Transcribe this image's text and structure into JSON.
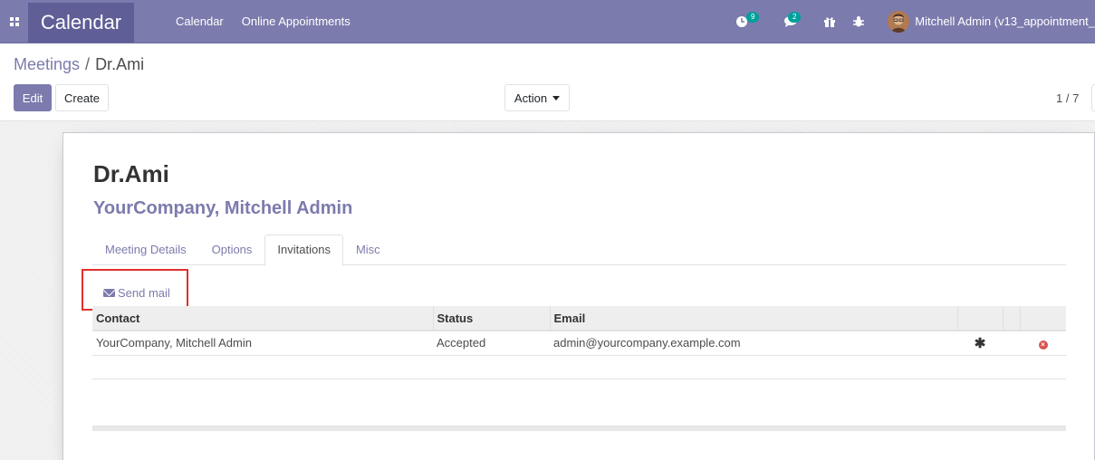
{
  "navbar": {
    "app_title": "Calendar",
    "menu": [
      "Calendar",
      "Online Appointments"
    ],
    "activity_count": "9",
    "messages_count": "2",
    "user_name": "Mitchell Admin (v13_appointment_"
  },
  "icons": {
    "apps": "apps-grid-icon",
    "activity": "clock-icon",
    "messages": "chat-icon",
    "gift": "gift-icon",
    "debug": "bug-icon",
    "send_mail": "envelope-icon",
    "required": "asterisk-icon",
    "delete": "remove-circle-icon"
  },
  "breadcrumb": {
    "parent": "Meetings",
    "separator": "/",
    "current": "Dr.Ami"
  },
  "buttons": {
    "edit": "Edit",
    "create": "Create",
    "action": "Action"
  },
  "pager": {
    "value": "1 / 7"
  },
  "record": {
    "title": "Dr.Ami",
    "subtitle": "YourCompany, Mitchell Admin"
  },
  "tabs": [
    "Meeting Details",
    "Options",
    "Invitations",
    "Misc"
  ],
  "active_tab": "Invitations",
  "send_mail_label": "Send mail",
  "table": {
    "headers": [
      "Contact",
      "Status",
      "Email"
    ],
    "rows": [
      {
        "contact": "YourCompany, Mitchell Admin",
        "status": "Accepted",
        "email": "admin@yourcompany.example.com"
      }
    ]
  },
  "colors": {
    "brand": "#7c7bad",
    "brand_dark": "#5f5e97",
    "badge": "#00a09d",
    "highlight": "#e0302d",
    "delete": "#d9534f"
  }
}
